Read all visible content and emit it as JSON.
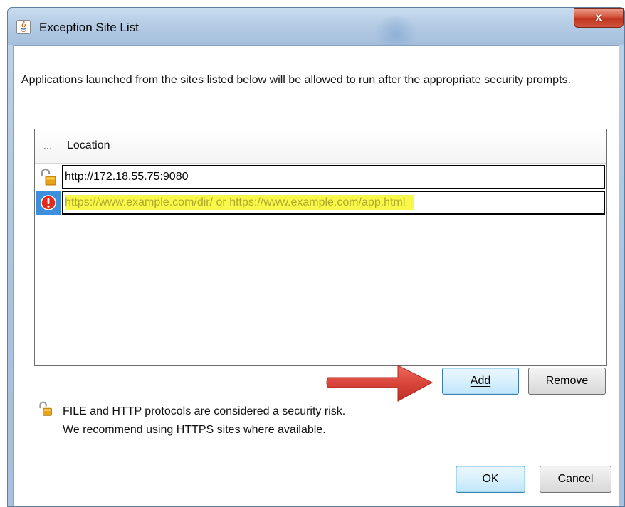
{
  "window": {
    "title": "Exception Site List",
    "close_label": "x"
  },
  "description": "Applications launched from the sites listed below will be allowed to run after the appropriate security prompts.",
  "table": {
    "columns": [
      "...",
      "Location"
    ],
    "rows": [
      {
        "icon": "unlocked-padlock-icon",
        "location": "http://172.18.55.75:9080"
      },
      {
        "icon": "error-icon",
        "location_placeholder": "https://www.example.com/dir/ or https://www.example.com/app.html"
      }
    ]
  },
  "buttons": {
    "add": "Add",
    "remove": "Remove",
    "ok": "OK",
    "cancel": "Cancel"
  },
  "security_note": {
    "line1": "FILE and HTTP protocols are considered a security risk.",
    "line2": "We recommend using HTTPS sites where available."
  },
  "colors": {
    "selection_blue": "#3d8fde",
    "placeholder_highlight": "#f8f84a",
    "arrow_red": "#d9453a",
    "close_red": "#c0361f"
  }
}
